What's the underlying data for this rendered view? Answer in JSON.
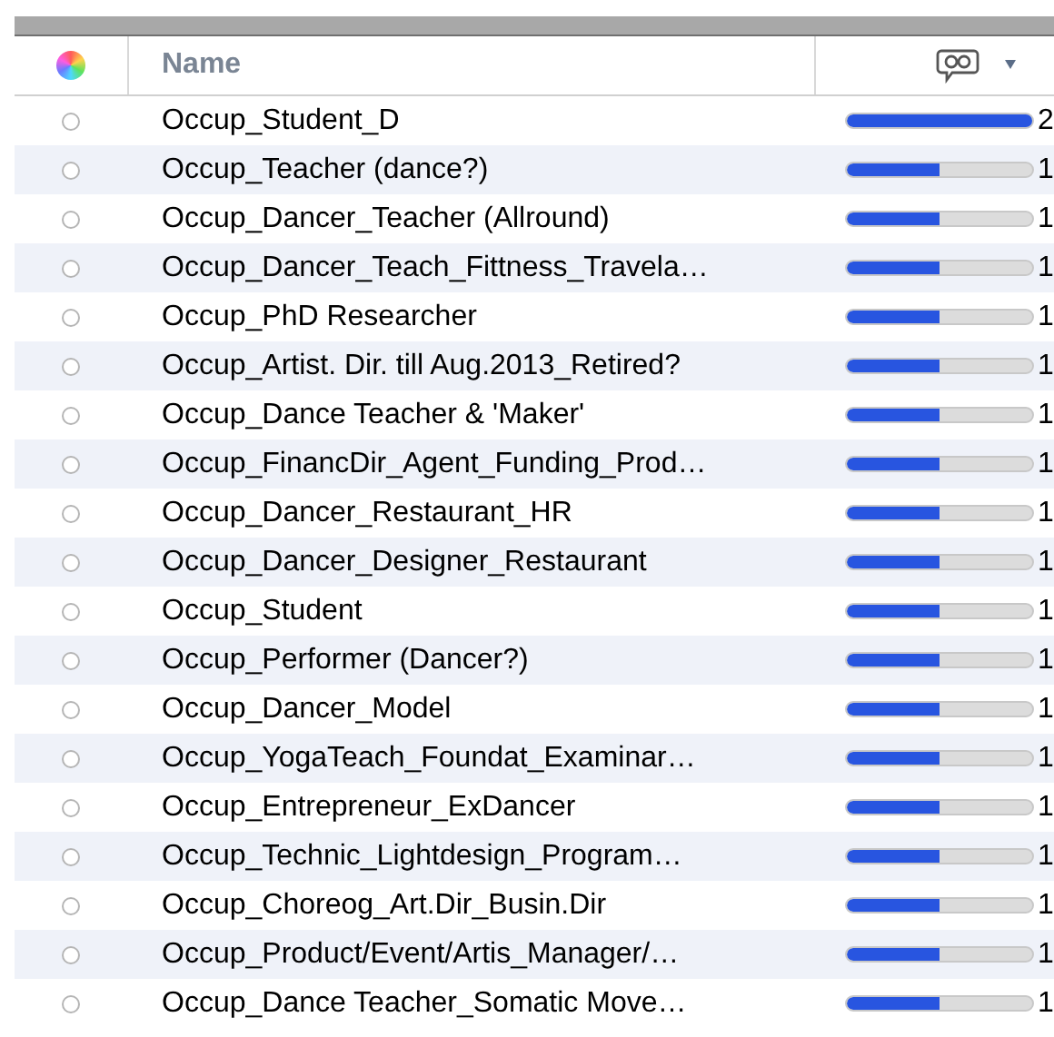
{
  "table": {
    "columns": [
      {
        "label": "Name"
      }
    ],
    "rows": [
      {
        "name": "Occup_Student_D",
        "level": 1.0,
        "count": "2"
      },
      {
        "name": "Occup_Teacher (dance?)",
        "level": 0.5,
        "count": "1"
      },
      {
        "name": "Occup_Dancer_Teacher (Allround)",
        "level": 0.5,
        "count": "1"
      },
      {
        "name": "Occup_Dancer_Teach_Fittness_Travela…",
        "level": 0.5,
        "count": "1"
      },
      {
        "name": "Occup_PhD Researcher",
        "level": 0.5,
        "count": "1"
      },
      {
        "name": "Occup_Artist. Dir. till Aug.2013_Retired?",
        "level": 0.5,
        "count": "1"
      },
      {
        "name": "Occup_Dance Teacher & 'Maker'",
        "level": 0.5,
        "count": "1"
      },
      {
        "name": "Occup_FinancDir_Agent_Funding_Prod…",
        "level": 0.5,
        "count": "1"
      },
      {
        "name": "Occup_Dancer_Restaurant_HR",
        "level": 0.5,
        "count": "1"
      },
      {
        "name": "Occup_Dancer_Designer_Restaurant",
        "level": 0.5,
        "count": "1"
      },
      {
        "name": "Occup_Student",
        "level": 0.5,
        "count": "1"
      },
      {
        "name": "Occup_Performer (Dancer?)",
        "level": 0.5,
        "count": "1"
      },
      {
        "name": "Occup_Dancer_Model",
        "level": 0.5,
        "count": "1"
      },
      {
        "name": "Occup_YogaTeach_Foundat_Examinar…",
        "level": 0.5,
        "count": "1"
      },
      {
        "name": "Occup_Entrepreneur_ExDancer",
        "level": 0.5,
        "count": "1"
      },
      {
        "name": "Occup_Technic_Lightdesign_Program…",
        "level": 0.5,
        "count": "1"
      },
      {
        "name": "Occup_Choreog_Art.Dir_Busin.Dir",
        "level": 0.5,
        "count": "1"
      },
      {
        "name": "Occup_Product/Event/Artis_Manager/…",
        "level": 0.5,
        "count": "1"
      },
      {
        "name": "Occup_Dance Teacher_Somatic Move…",
        "level": 0.5,
        "count": "1"
      }
    ]
  }
}
